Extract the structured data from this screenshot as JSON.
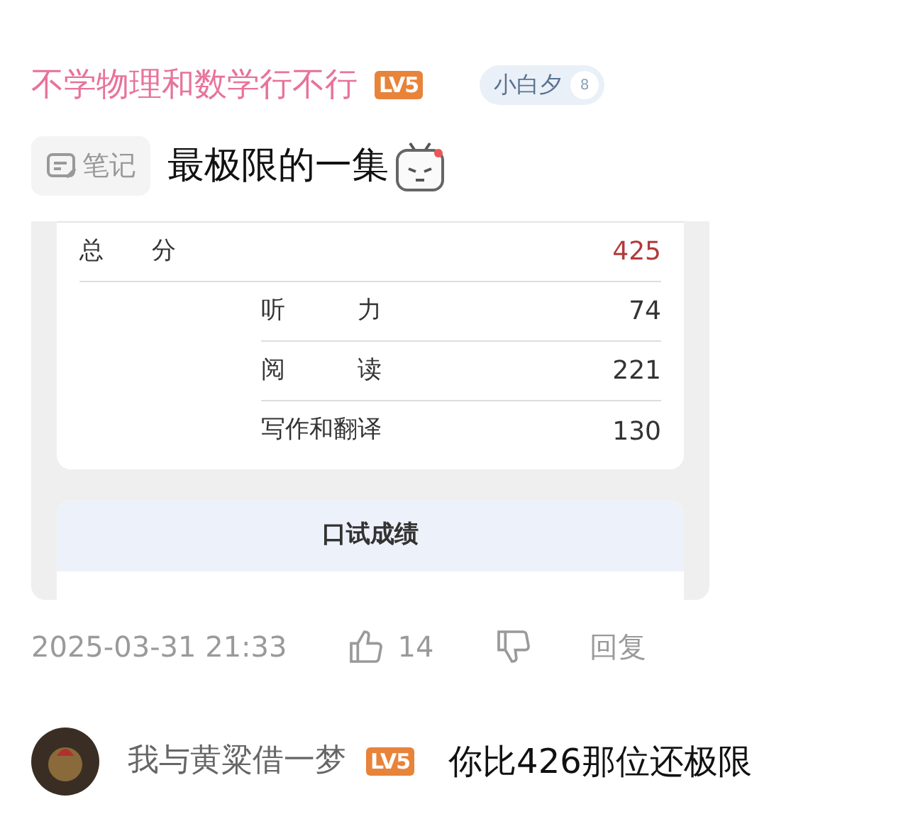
{
  "comment": {
    "username": "不学物理和数学行不行",
    "level_badge": "LV5",
    "fan_badge": {
      "name": "小白夕",
      "level": "8"
    },
    "tag": "笔记",
    "text": "最极限的一集",
    "image": {
      "kind": "picture-screenshot",
      "total": {
        "label": "总　　分",
        "value": "425"
      },
      "parts": [
        {
          "label": "听　　　力",
          "value": "74"
        },
        {
          "label": "阅　　　读",
          "value": "221"
        },
        {
          "label": "写作和翻译",
          "value": "130"
        }
      ],
      "oral_header": "口试成绩"
    },
    "time": "2025-03-31 21:33",
    "likes": "14",
    "reply_button": "回复"
  },
  "reply": {
    "username": "我与黄粱借一梦",
    "level_badge": "LV5",
    "text": "你比426那位还极限"
  }
}
